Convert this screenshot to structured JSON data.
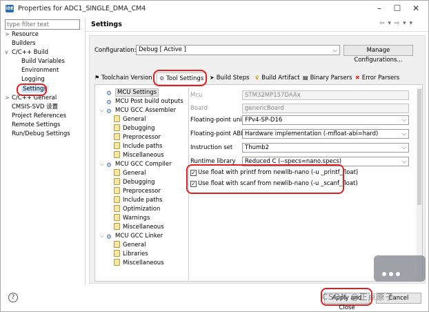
{
  "window": {
    "title": "Properties for ADC1_SINGLE_DMA_CM4",
    "app_icon": "IDE",
    "minimize": "–",
    "maximize": "☐",
    "close": "✕"
  },
  "sidebar": {
    "filter_placeholder": "type filter text",
    "items": [
      {
        "label": "Resource",
        "twisty": ">"
      },
      {
        "label": "Builders",
        "twisty": ""
      },
      {
        "label": "C/C++ Build",
        "twisty": "v"
      },
      {
        "label": "Build Variables",
        "twisty": ""
      },
      {
        "label": "Environment",
        "twisty": ""
      },
      {
        "label": "Logging",
        "twisty": ""
      },
      {
        "label": "Settings",
        "twisty": ""
      },
      {
        "label": "C/C++ General",
        "twisty": ">"
      },
      {
        "label": "CMSIS-SVD 设置",
        "twisty": ""
      },
      {
        "label": "Project References",
        "twisty": ""
      },
      {
        "label": "Remote Settings",
        "twisty": ""
      },
      {
        "label": "Run/Debug Settings",
        "twisty": ""
      }
    ]
  },
  "header": {
    "title": "Settings",
    "nav": "⇦ ▾ ⇨ ▾ ▾"
  },
  "configuration": {
    "label": "Configuration:",
    "value": "Debug  [ Active ]",
    "manage_button": "Manage Configurations..."
  },
  "tabs": [
    {
      "label": "Toolchain  Version",
      "icon": "toolchain-icon",
      "glyph": "⚑"
    },
    {
      "label": "Tool Settings",
      "icon": "tool-settings-icon",
      "glyph": "⚙"
    },
    {
      "label": "Build Steps",
      "icon": "build-steps-icon",
      "glyph": "➤"
    },
    {
      "label": "Build Artifact",
      "icon": "build-artifact-icon",
      "glyph": "♛"
    },
    {
      "label": "Binary Parsers",
      "icon": "binary-parsers-icon",
      "glyph": "▤"
    },
    {
      "label": "Error Parsers",
      "icon": "error-parsers-icon",
      "glyph": "✖"
    }
  ],
  "tool_tree": [
    {
      "label": "MCU Settings",
      "type": "gear",
      "fold": ""
    },
    {
      "label": "MCU Post build outputs",
      "type": "gear",
      "fold": ""
    },
    {
      "label": "MCU GCC Assembler",
      "type": "gear",
      "fold": "v"
    },
    {
      "label": "General",
      "type": "page",
      "fold": ""
    },
    {
      "label": "Debugging",
      "type": "page",
      "fold": ""
    },
    {
      "label": "Preprocessor",
      "type": "page",
      "fold": ""
    },
    {
      "label": "Include paths",
      "type": "page",
      "fold": ""
    },
    {
      "label": "Miscellaneous",
      "type": "page",
      "fold": ""
    },
    {
      "label": "MCU GCC Compiler",
      "type": "gear",
      "fold": "v"
    },
    {
      "label": "General",
      "type": "page",
      "fold": ""
    },
    {
      "label": "Debugging",
      "type": "page",
      "fold": ""
    },
    {
      "label": "Preprocessor",
      "type": "page",
      "fold": ""
    },
    {
      "label": "Include paths",
      "type": "page",
      "fold": ""
    },
    {
      "label": "Optimization",
      "type": "page",
      "fold": ""
    },
    {
      "label": "Warnings",
      "type": "page",
      "fold": ""
    },
    {
      "label": "Miscellaneous",
      "type": "page",
      "fold": ""
    },
    {
      "label": "MCU GCC Linker",
      "type": "gear",
      "fold": "v"
    },
    {
      "label": "General",
      "type": "page",
      "fold": ""
    },
    {
      "label": "Libraries",
      "type": "page",
      "fold": ""
    },
    {
      "label": "Miscellaneous",
      "type": "page",
      "fold": ""
    }
  ],
  "properties": [
    {
      "label": "Mcu",
      "value": "STM32MP157DAAx",
      "disabled": true,
      "dropdown": false
    },
    {
      "label": "Board",
      "value": "genericBoard",
      "disabled": true,
      "dropdown": false
    },
    {
      "label": "Floating-point unit",
      "value": "FPv4-SP-D16",
      "disabled": false,
      "dropdown": true
    },
    {
      "label": "Floating-point ABI",
      "value": "Hardware implementation (-mfloat-abi=hard)",
      "disabled": false,
      "dropdown": true
    },
    {
      "label": "Instruction set",
      "value": "Thumb2",
      "disabled": false,
      "dropdown": true
    },
    {
      "label": "Runtime library",
      "value": "Reduced C (--specs=nano.specs)",
      "disabled": false,
      "dropdown": true
    }
  ],
  "checkboxes": [
    {
      "label": "Use float with printf from newlib-nano (-u _printf_float)",
      "checked": true
    },
    {
      "label": "Use float with scanf from newlib-nano (-u _scanf_float)",
      "checked": true
    }
  ],
  "footer": {
    "help": "?",
    "apply_close": "Apply and Close",
    "cancel": "Cancel"
  },
  "watermark": {
    "text": "CSDN @正点原子"
  },
  "colors": {
    "annotation": "#e01e1e",
    "selection": "#cde4f7"
  }
}
